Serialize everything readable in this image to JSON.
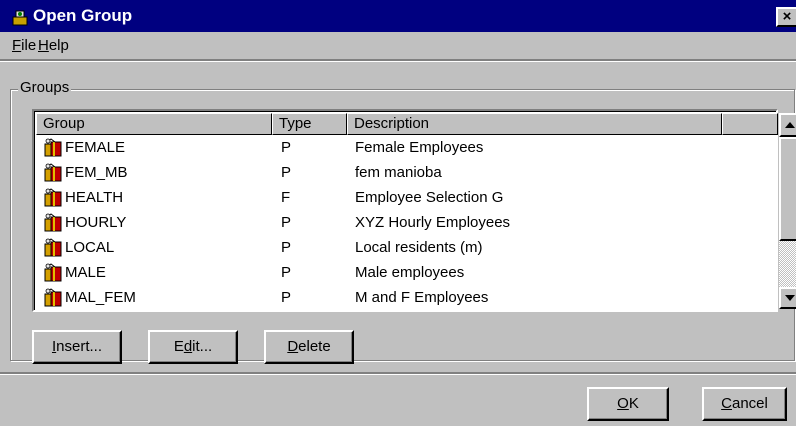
{
  "window": {
    "title": "Open Group",
    "close_label": "×",
    "app_icon": "database-key-icon"
  },
  "menu": [
    {
      "label_u": "F",
      "label_rest": "ile"
    },
    {
      "label_u": "H",
      "label_rest": "elp"
    }
  ],
  "groups_frame": {
    "label": "Groups"
  },
  "list": {
    "columns": [
      "Group",
      "Type",
      "Description"
    ],
    "rows": [
      {
        "group": "FEMALE",
        "type": "P",
        "description": "Female Employees"
      },
      {
        "group": "FEM_MB",
        "type": "P",
        "description": "fem manioba"
      },
      {
        "group": "HEALTH",
        "type": "F",
        "description": "Employee Selection G"
      },
      {
        "group": "HOURLY",
        "type": "P",
        "description": "XYZ Hourly Employees"
      },
      {
        "group": "LOCAL",
        "type": "P",
        "description": "Local residents (m)"
      },
      {
        "group": "MALE",
        "type": "P",
        "description": "Male employees"
      },
      {
        "group": "MAL_FEM",
        "type": "P",
        "description": "M and F Employees"
      }
    ],
    "row_icon": "group-gift-icon"
  },
  "buttons": {
    "insert": {
      "u": "I",
      "rest": "nsert..."
    },
    "edit": {
      "pre": "E",
      "u": "d",
      "rest": "it..."
    },
    "delete": {
      "u": "D",
      "rest": "elete"
    },
    "ok": {
      "u": "O",
      "rest": "K"
    },
    "cancel": {
      "u": "C",
      "rest": "ancel"
    }
  }
}
